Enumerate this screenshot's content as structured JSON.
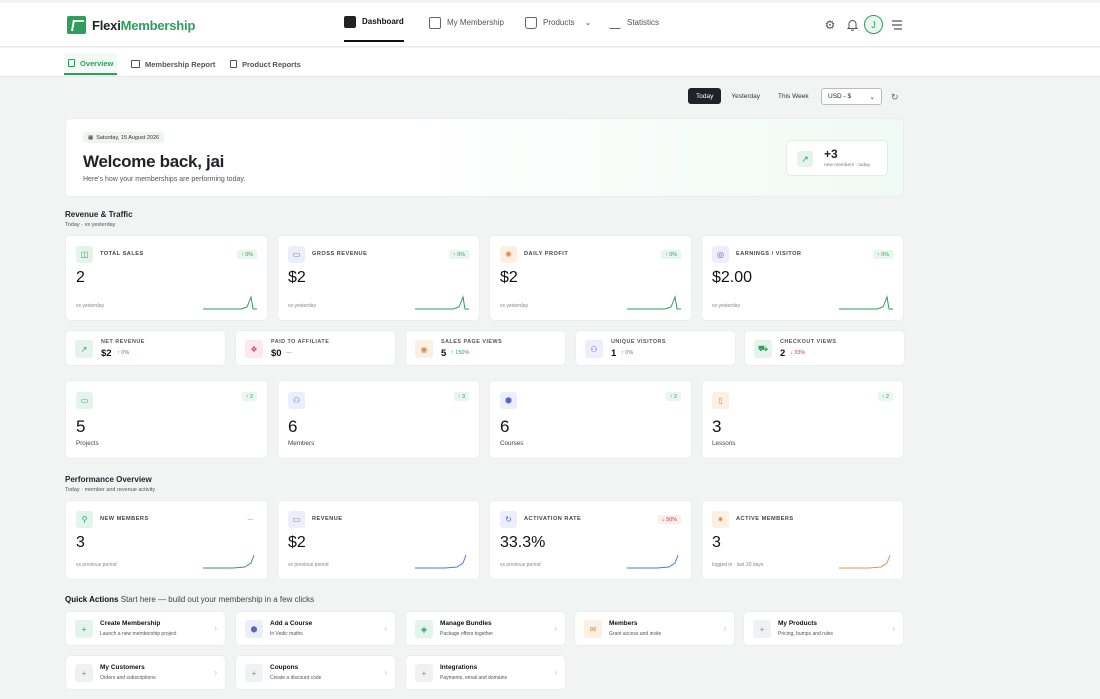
{
  "brand": {
    "part1": "Flexi",
    "part2": "Membership"
  },
  "nav": [
    {
      "label": "Dashboard",
      "icon": "dashboard-icon"
    },
    {
      "label": "My Membership",
      "icon": "membership-icon"
    },
    {
      "label": "Products",
      "icon": "bag-icon"
    },
    {
      "label": "Statistics",
      "icon": "chart-icon"
    }
  ],
  "user": {
    "initial": "J"
  },
  "subtabs": [
    {
      "label": "Overview"
    },
    {
      "label": "Membership Report"
    },
    {
      "label": "Product Reports"
    }
  ],
  "filters": {
    "today": "Today",
    "yesterday": "Yesterday",
    "week": "This Week",
    "currency": "USD - $"
  },
  "welcome": {
    "date": "Saturday, 15 August 2026",
    "title": "Welcome back, jai",
    "subtitle": "Here's how your memberships are performing today.",
    "new_count": "+3",
    "new_label": "new members · today"
  },
  "revenue_section": {
    "title": "Revenue & Traffic",
    "subtitle": "Today · vs yesterday"
  },
  "stats": [
    {
      "label": "TOTAL SALES",
      "value": "2",
      "delta": "0%",
      "vs": "vs yesterday"
    },
    {
      "label": "GROSS REVENUE",
      "value": "$2",
      "delta": "0%",
      "vs": "vs yesterday"
    },
    {
      "label": "DAILY PROFIT",
      "value": "$2",
      "delta": "0%",
      "vs": "vs yesterday"
    },
    {
      "label": "EARNINGS / VISITOR",
      "value": "$2.00",
      "delta": "0%",
      "vs": "vs yesterday"
    }
  ],
  "minis": [
    {
      "label": "NET REVENUE",
      "value": "$2",
      "delta": "0%"
    },
    {
      "label": "PAID TO AFFILIATE",
      "value": "$0",
      "delta": "—"
    },
    {
      "label": "SALES PAGE VIEWS",
      "value": "5",
      "delta": "150%"
    },
    {
      "label": "UNIQUE VISITORS",
      "value": "1",
      "delta": "0%"
    },
    {
      "label": "CHECKOUT VIEWS",
      "value": "2",
      "delta": "33%"
    }
  ],
  "counts": [
    {
      "value": "5",
      "label": "Projects",
      "badge": "2"
    },
    {
      "value": "6",
      "label": "Members",
      "badge": "3"
    },
    {
      "value": "6",
      "label": "Courses",
      "badge": "2"
    },
    {
      "value": "3",
      "label": "Lessons",
      "badge": "2"
    }
  ],
  "performance_section": {
    "title": "Performance Overview",
    "subtitle": "Today · member and revenue activity"
  },
  "perf": [
    {
      "label": "NEW MEMBERS",
      "value": "3",
      "delta": "—",
      "vs": "vs previous period"
    },
    {
      "label": "REVENUE",
      "value": "$2",
      "delta": "",
      "vs": "vs previous period"
    },
    {
      "label": "ACTIVATION RATE",
      "value": "33.3%",
      "delta": "50%",
      "vs": "vs previous period"
    },
    {
      "label": "ACTIVE MEMBERS",
      "value": "3",
      "delta": "",
      "vs": "logged in · last 30 days"
    }
  ],
  "quick": {
    "title": "Quick Actions",
    "subtitle": "Start here — build out your membership in a few clicks"
  },
  "actions": [
    {
      "title": "Create Membership",
      "sub": "Launch a new membership project"
    },
    {
      "title": "Add a Course",
      "sub": "In Vedic maths"
    },
    {
      "title": "Manage Bundles",
      "sub": "Package offers together"
    },
    {
      "title": "Members",
      "sub": "Grant access and invite"
    },
    {
      "title": "My Products",
      "sub": "Pricing, bumps and rules"
    },
    {
      "title": "My Customers",
      "sub": "Orders and subscriptions"
    },
    {
      "title": "Coupons",
      "sub": "Create a discount code"
    },
    {
      "title": "Integrations",
      "sub": "Payments, email and domains"
    }
  ],
  "colors": {
    "accent": "#2e9e5b",
    "down": "#d23c3c",
    "spark_blue": "#3f7fe0",
    "spark_orange": "#e8944a"
  }
}
